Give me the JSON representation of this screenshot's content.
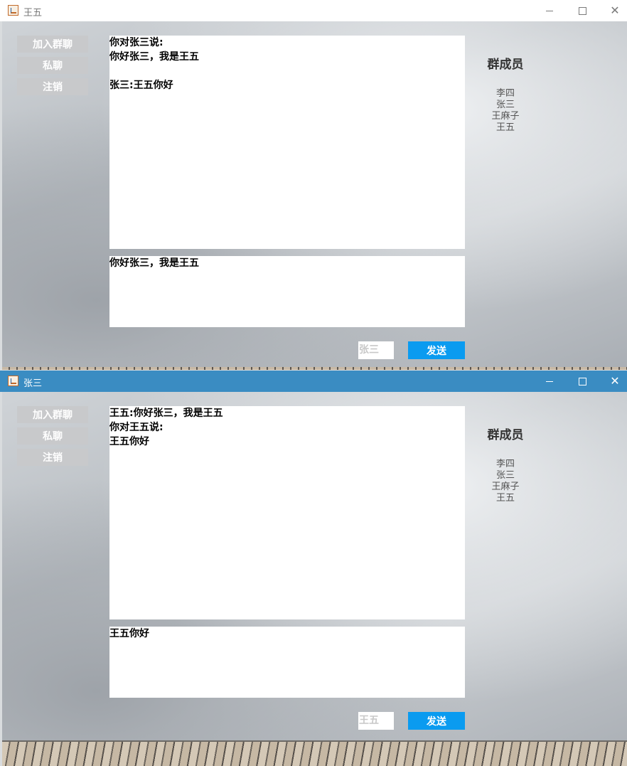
{
  "windows": [
    {
      "title": "王五",
      "state": "inactive",
      "buttons": {
        "join_group": "加入群聊",
        "private_chat": "私聊",
        "logout": "注销"
      },
      "chat_lines": [
        "你对张三说:",
        "你好张三，我是王五",
        "",
        "张三:王五你好"
      ],
      "input_text": "你好张三，我是王五",
      "target_user": "张三",
      "send_label": "发送",
      "members_title": "群成员",
      "members": [
        "李四",
        "张三",
        "王麻子",
        "王五"
      ]
    },
    {
      "title": "张三",
      "state": "active",
      "buttons": {
        "join_group": "加入群聊",
        "private_chat": "私聊",
        "logout": "注销"
      },
      "chat_lines": [
        "王五:你好张三，我是王五",
        "你对王五说:",
        "王五你好"
      ],
      "input_text": "王五你好",
      "target_user": "王五",
      "send_label": "发送",
      "members_title": "群成员",
      "members": [
        "李四",
        "张三",
        "王麻子",
        "王五"
      ]
    }
  ],
  "colors": {
    "active_titlebar": "#3a8cc2",
    "send_button": "#0a9bf0",
    "side_button": "#c8c9cb"
  }
}
